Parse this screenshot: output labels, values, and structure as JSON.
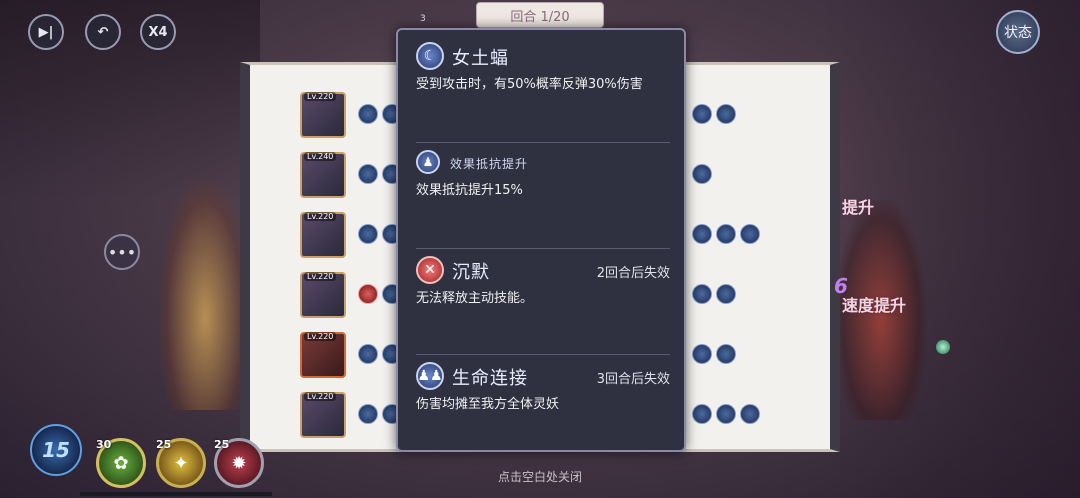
{
  "controls": {
    "pause_icon": "skip-pause-icon",
    "undo_icon": "undo-icon",
    "speed_label": "X4"
  },
  "status_button": {
    "label": "状态"
  },
  "round_tab": {
    "label": "回合 1/20"
  },
  "round_small": "3",
  "tooltip": {
    "sections": [
      {
        "icon": "female-earth-bat-icon",
        "title": "女土蝠",
        "expire": "",
        "desc": "受到攻击时，有50%概率反弹30%伤害"
      },
      {
        "icon": "effect-resist-up-icon",
        "title": "效果抵抗提升",
        "expire": "",
        "desc": "效果抵抗提升15%"
      },
      {
        "icon": "silence-icon",
        "title": "沉默",
        "expire": "2回合后失效",
        "desc": "无法释放主动技能。"
      },
      {
        "icon": "life-link-icon",
        "title": "生命连接",
        "expire": "3回合后失效",
        "desc": "伤害均摊至我方全体灵妖"
      }
    ]
  },
  "roster": [
    {
      "level": "Lv.220"
    },
    {
      "level": "Lv.240"
    },
    {
      "level": "Lv.220"
    },
    {
      "level": "Lv.220"
    },
    {
      "level": "Lv.220"
    },
    {
      "level": "Lv.220"
    }
  ],
  "close_hint": "点击空白处关闭",
  "energy": {
    "value": "15"
  },
  "skills": [
    {
      "cost": "30",
      "icon": "grass-skill-icon"
    },
    {
      "cost": "25",
      "icon": "light-skill-icon"
    },
    {
      "cost": "25",
      "icon": "fire-skill-icon"
    }
  ],
  "floating_texts": {
    "top": "提升",
    "bottom": "速度提升",
    "number": "6"
  },
  "colors": {
    "tooltip_bg": "#2f3140",
    "tooltip_border": "#8a8aa8",
    "panel_bg": "#f3f1ee",
    "accent_blue": "#6a86c8",
    "silence_red": "#c03030"
  }
}
